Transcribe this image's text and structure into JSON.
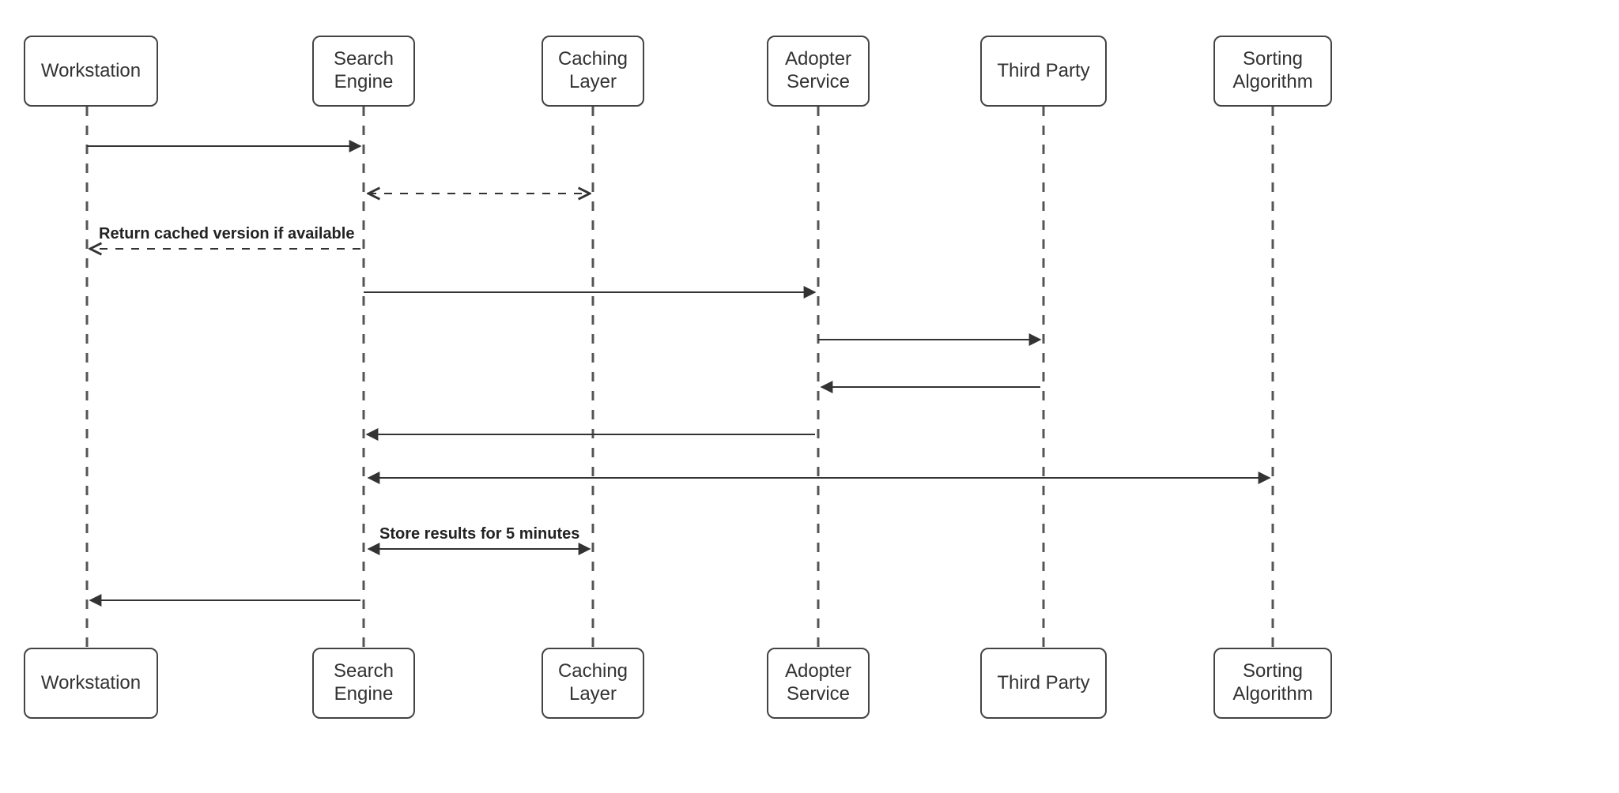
{
  "participants": {
    "workstation": "Workstation",
    "search_engine": "Search\nEngine",
    "caching_layer": "Caching\nLayer",
    "adopter_service": "Adopter\nService",
    "third_party": "Third Party",
    "sorting_algorithm": "Sorting\nAlgorithm"
  },
  "messages": {
    "return_cached": "Return cached version if available",
    "store_results": "Store results for 5 minutes"
  },
  "layout_hint": {
    "participant_x": {
      "workstation": 110,
      "search_engine": 460,
      "caching_layer": 750,
      "adopter_service": 1035,
      "third_party": 1320,
      "sorting_algorithm": 1610
    }
  }
}
